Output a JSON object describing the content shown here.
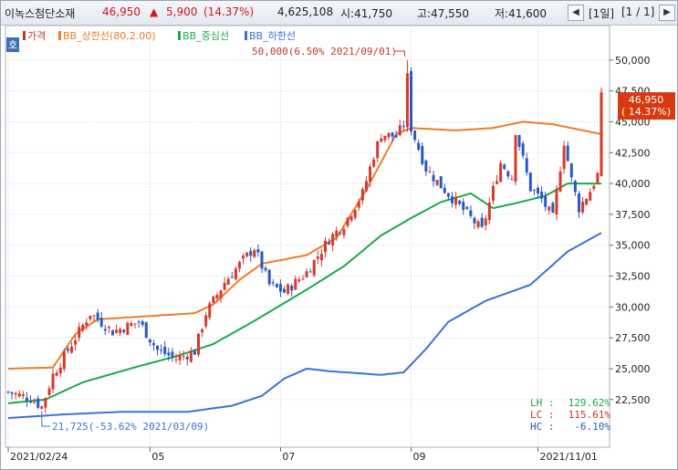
{
  "header": {
    "stock_name": "이녹스첨단소재",
    "price": "46,950",
    "change_arrow": "▲",
    "change": "5,900",
    "change_pct": "(14.37%)",
    "volume": "4,625,108",
    "open": "시:41,750",
    "high": "고:47,550",
    "low": "저:41,600",
    "period": "[1일]",
    "page": "[1 / 1]",
    "nav_prev_icon": "chevron-left-icon",
    "nav_next_icon": "chevron-right-icon"
  },
  "side_button": "호",
  "legend": [
    {
      "label": "가격",
      "color": "#c0392b"
    },
    {
      "label": "BB_상한선(80,2.00)",
      "color": "#f07b2a"
    },
    {
      "label": "BB_중심선",
      "color": "#1ea84a"
    },
    {
      "label": "BB_하한선",
      "color": "#3a72d8"
    }
  ],
  "annotations": {
    "high_label": "50,000(6.50% 2021/09/01)",
    "low_label": "21,725(-53.62% 2021/03/09)",
    "current_price": "46,950",
    "current_pct": "( 14.37%)"
  },
  "stats": [
    {
      "label": "LH :",
      "value": "129.62%",
      "color": "#1ea84a"
    },
    {
      "label": "LC :",
      "value": "115.61%",
      "color": "#c0392b"
    },
    {
      "label": "HC :",
      "value": "-6.10%",
      "color": "#2b59c3"
    }
  ],
  "colors": {
    "up": "#d63a2a",
    "down": "#2b59c3",
    "upper": "#f07b2a",
    "middle": "#1ea84a",
    "lower": "#3a72d8"
  },
  "chart_data": {
    "type": "candlestick",
    "y_ticks": [
      "50,000",
      "47,500",
      "45,000",
      "42,500",
      "40,000",
      "37,500",
      "35,000",
      "32,500",
      "30,000",
      "27,500",
      "25,000",
      "22,500"
    ],
    "ylim": [
      20000,
      52000
    ],
    "x_ticks": [
      "2021/02/24",
      "05",
      "07",
      "09",
      "2021/11/01"
    ],
    "x_tick_pos": [
      0,
      38,
      73,
      108,
      142
    ],
    "n_days": 160,
    "price_anchors": [
      [
        0,
        23100
      ],
      [
        6,
        22600
      ],
      [
        9,
        21900
      ],
      [
        12,
        24500
      ],
      [
        16,
        26500
      ],
      [
        22,
        29500
      ],
      [
        28,
        28000
      ],
      [
        35,
        28800
      ],
      [
        40,
        26500
      ],
      [
        45,
        25800
      ],
      [
        50,
        26400
      ],
      [
        53,
        29500
      ],
      [
        58,
        32000
      ],
      [
        63,
        33800
      ],
      [
        66,
        34800
      ],
      [
        70,
        31800
      ],
      [
        74,
        31200
      ],
      [
        80,
        32800
      ],
      [
        86,
        35500
      ],
      [
        90,
        36700
      ],
      [
        95,
        39200
      ],
      [
        98,
        42300
      ],
      [
        100,
        44000
      ],
      [
        104,
        43800
      ],
      [
        106,
        44800
      ],
      [
        107,
        48600
      ],
      [
        108,
        44500
      ],
      [
        112,
        41200
      ],
      [
        116,
        39800
      ],
      [
        120,
        38500
      ],
      [
        124,
        37200
      ],
      [
        127,
        36200
      ],
      [
        129,
        38400
      ],
      [
        132,
        41700
      ],
      [
        135,
        40500
      ],
      [
        136,
        44300
      ],
      [
        140,
        39600
      ],
      [
        143,
        38700
      ],
      [
        146,
        37200
      ],
      [
        149,
        43400
      ],
      [
        151,
        40300
      ],
      [
        153,
        38000
      ],
      [
        156,
        39400
      ],
      [
        158,
        40700
      ],
      [
        159,
        46950
      ]
    ],
    "upper_band": [
      [
        0,
        25000
      ],
      [
        12,
        25100
      ],
      [
        18,
        27800
      ],
      [
        24,
        29000
      ],
      [
        40,
        29300
      ],
      [
        50,
        29500
      ],
      [
        55,
        30200
      ],
      [
        62,
        32200
      ],
      [
        68,
        33500
      ],
      [
        80,
        34200
      ],
      [
        88,
        35600
      ],
      [
        96,
        39500
      ],
      [
        104,
        44000
      ],
      [
        108,
        44500
      ],
      [
        120,
        44300
      ],
      [
        130,
        44500
      ],
      [
        138,
        45000
      ],
      [
        146,
        44800
      ],
      [
        159,
        44000
      ]
    ],
    "middle_band": [
      [
        0,
        22200
      ],
      [
        10,
        22500
      ],
      [
        20,
        23900
      ],
      [
        35,
        25200
      ],
      [
        45,
        26000
      ],
      [
        55,
        27000
      ],
      [
        65,
        28700
      ],
      [
        80,
        31400
      ],
      [
        90,
        33300
      ],
      [
        100,
        35800
      ],
      [
        108,
        37200
      ],
      [
        116,
        38500
      ],
      [
        124,
        39200
      ],
      [
        130,
        38000
      ],
      [
        136,
        38400
      ],
      [
        144,
        39000
      ],
      [
        150,
        40000
      ],
      [
        159,
        40000
      ]
    ],
    "lower_band": [
      [
        0,
        21000
      ],
      [
        15,
        21300
      ],
      [
        30,
        21500
      ],
      [
        48,
        21500
      ],
      [
        60,
        22000
      ],
      [
        68,
        22800
      ],
      [
        74,
        24200
      ],
      [
        80,
        25000
      ],
      [
        86,
        24800
      ],
      [
        100,
        24500
      ],
      [
        106,
        24700
      ],
      [
        112,
        26600
      ],
      [
        118,
        28800
      ],
      [
        128,
        30500
      ],
      [
        140,
        31800
      ],
      [
        150,
        34500
      ],
      [
        159,
        36000
      ]
    ],
    "high_point": {
      "x": 107,
      "value": 50000
    },
    "low_point": {
      "x": 9,
      "value": 21725
    }
  }
}
